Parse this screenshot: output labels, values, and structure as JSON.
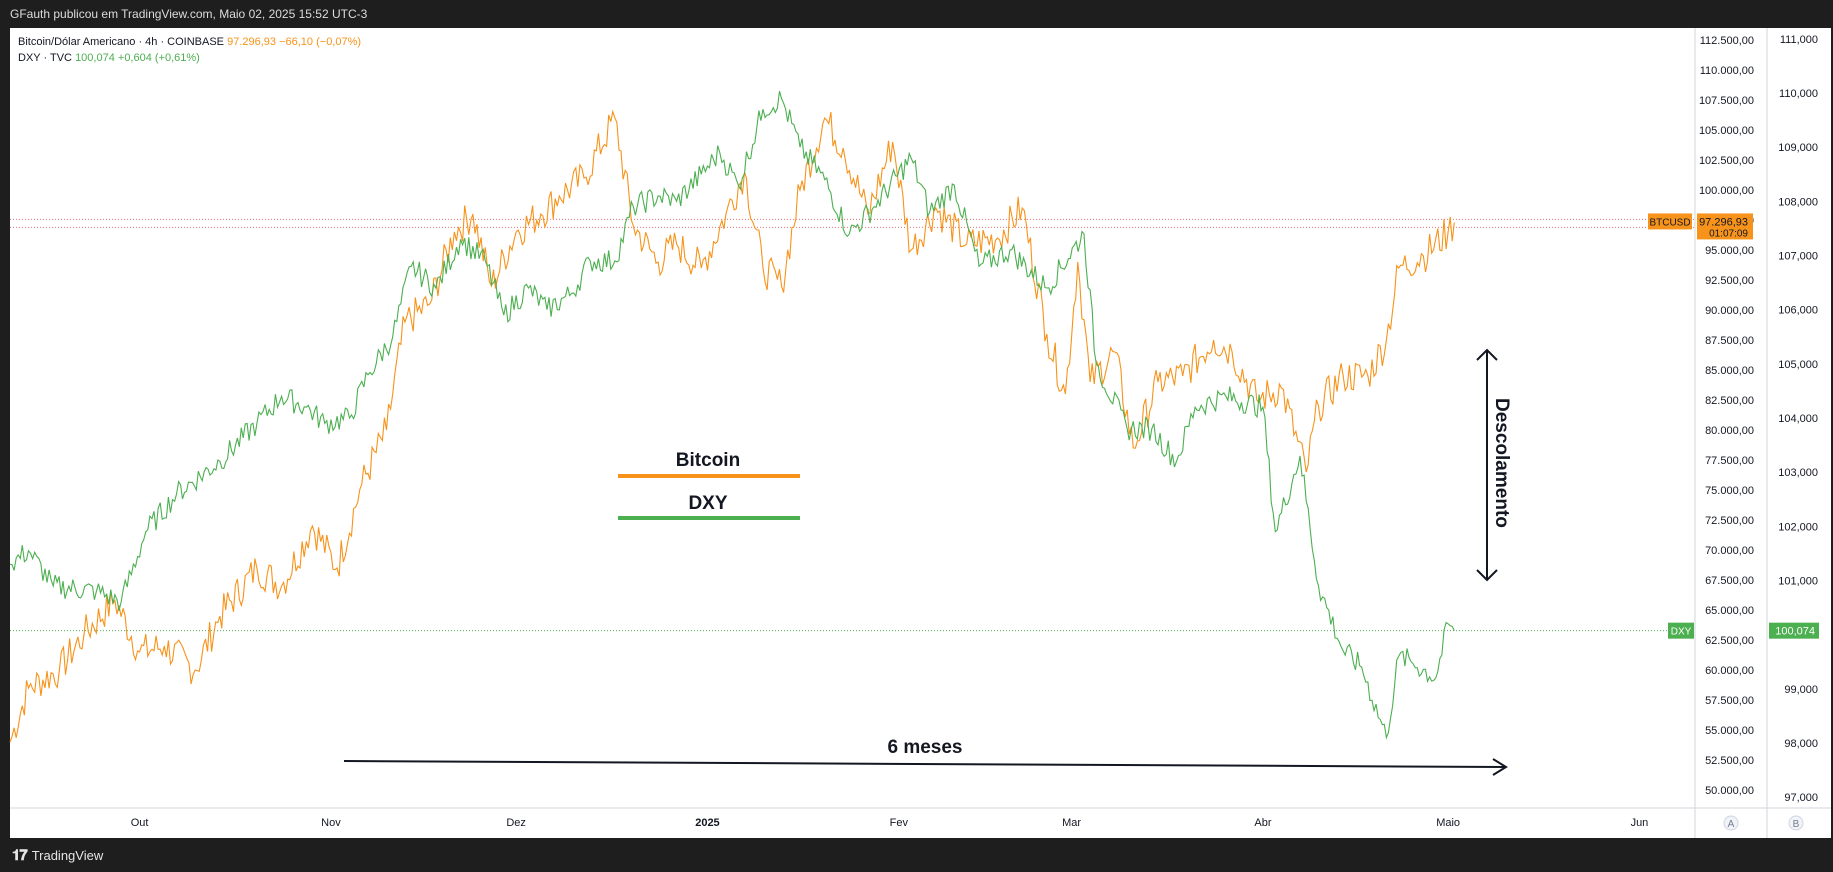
{
  "header": {
    "publisher_line": "GFauth publicou em TradingView.com, Maio 02, 2025 15:52 UTC-3"
  },
  "legend": {
    "btc": {
      "name": "Bitcoin/Dólar Americano · 4h · COINBASE",
      "price": "97.296,93",
      "change": "−66,10 (−0,07%)"
    },
    "dxy": {
      "name": "DXY · TVC",
      "price": "100,074",
      "change": "+0,604 (+0,61%)"
    }
  },
  "footer": {
    "brand": "TradingView"
  },
  "chart_data": {
    "type": "line",
    "x_label_months": [
      "Out",
      "Nov",
      "Dez",
      "2025",
      "Fev",
      "Mar",
      "Abr",
      "Maio",
      "Jun"
    ],
    "x_range": [
      "2024-09-10",
      "2025-06-10"
    ],
    "series": [
      {
        "name": "BTCUSD",
        "axis": "A",
        "color": "#f7931a",
        "points": [
          [
            "2024-09-10",
            54000
          ],
          [
            "2024-09-13",
            58500
          ],
          [
            "2024-09-18",
            60000
          ],
          [
            "2024-09-22",
            63000
          ],
          [
            "2024-09-27",
            65800
          ],
          [
            "2024-10-01",
            61500
          ],
          [
            "2024-10-05",
            62000
          ],
          [
            "2024-10-10",
            60000
          ],
          [
            "2024-10-14",
            64500
          ],
          [
            "2024-10-20",
            68500
          ],
          [
            "2024-10-24",
            67000
          ],
          [
            "2024-10-29",
            72000
          ],
          [
            "2024-11-02",
            68500
          ],
          [
            "2024-11-06",
            75500
          ],
          [
            "2024-11-10",
            80000
          ],
          [
            "2024-11-13",
            89000
          ],
          [
            "2024-11-17",
            90500
          ],
          [
            "2024-11-21",
            96500
          ],
          [
            "2024-11-24",
            98000
          ],
          [
            "2024-11-27",
            92000
          ],
          [
            "2024-12-01",
            96500
          ],
          [
            "2024-12-05",
            98000
          ],
          [
            "2024-12-08",
            99500
          ],
          [
            "2024-12-12",
            101000
          ],
          [
            "2024-12-17",
            106000
          ],
          [
            "2024-12-20",
            97000
          ],
          [
            "2024-12-24",
            94000
          ],
          [
            "2024-12-27",
            95500
          ],
          [
            "2024-12-31",
            93500
          ],
          [
            "2025-01-04",
            98000
          ],
          [
            "2025-01-07",
            101500
          ],
          [
            "2025-01-10",
            93500
          ],
          [
            "2025-01-13",
            92000
          ],
          [
            "2025-01-16",
            100000
          ],
          [
            "2025-01-20",
            106000
          ],
          [
            "2025-01-23",
            103500
          ],
          [
            "2025-01-27",
            98000
          ],
          [
            "2025-01-31",
            104000
          ],
          [
            "2025-02-03",
            95000
          ],
          [
            "2025-02-07",
            98500
          ],
          [
            "2025-02-12",
            95500
          ],
          [
            "2025-02-17",
            96000
          ],
          [
            "2025-02-21",
            98500
          ],
          [
            "2025-02-25",
            88000
          ],
          [
            "2025-02-28",
            83000
          ],
          [
            "2025-03-02",
            94000
          ],
          [
            "2025-03-04",
            84000
          ],
          [
            "2025-03-08",
            86500
          ],
          [
            "2025-03-11",
            78500
          ],
          [
            "2025-03-15",
            84000
          ],
          [
            "2025-03-19",
            84500
          ],
          [
            "2025-03-24",
            87500
          ],
          [
            "2025-03-27",
            86500
          ],
          [
            "2025-03-31",
            82500
          ],
          [
            "2025-04-04",
            83500
          ],
          [
            "2025-04-08",
            76500
          ],
          [
            "2025-04-10",
            82000
          ],
          [
            "2025-04-14",
            84500
          ],
          [
            "2025-04-18",
            84500
          ],
          [
            "2025-04-21",
            87500
          ],
          [
            "2025-04-23",
            93500
          ],
          [
            "2025-04-27",
            94500
          ],
          [
            "2025-05-01",
            96500
          ],
          [
            "2025-05-02",
            97296.93
          ]
        ]
      },
      {
        "name": "DXY",
        "axis": "B",
        "color": "#4caf50",
        "points": [
          [
            "2024-09-10",
            101.3
          ],
          [
            "2024-09-13",
            101.55
          ],
          [
            "2024-09-17",
            100.9
          ],
          [
            "2024-09-24",
            100.8
          ],
          [
            "2024-09-28",
            100.6
          ],
          [
            "2024-10-02",
            101.9
          ],
          [
            "2024-10-07",
            102.6
          ],
          [
            "2024-10-14",
            103.2
          ],
          [
            "2024-10-20",
            103.9
          ],
          [
            "2024-10-24",
            104.4
          ],
          [
            "2024-10-28",
            104.2
          ],
          [
            "2024-10-31",
            103.9
          ],
          [
            "2024-11-04",
            104.0
          ],
          [
            "2024-11-07",
            104.8
          ],
          [
            "2024-11-11",
            105.5
          ],
          [
            "2024-11-14",
            106.8
          ],
          [
            "2024-11-18",
            106.4
          ],
          [
            "2024-11-22",
            107.3
          ],
          [
            "2024-11-26",
            106.9
          ],
          [
            "2024-11-29",
            105.9
          ],
          [
            "2024-12-03",
            106.4
          ],
          [
            "2024-12-06",
            106.0
          ],
          [
            "2024-12-10",
            106.3
          ],
          [
            "2024-12-13",
            106.9
          ],
          [
            "2024-12-17",
            106.9
          ],
          [
            "2024-12-20",
            107.9
          ],
          [
            "2024-12-24",
            108.1
          ],
          [
            "2024-12-27",
            108.0
          ],
          [
            "2024-12-31",
            108.5
          ],
          [
            "2025-01-03",
            108.9
          ],
          [
            "2025-01-06",
            108.3
          ],
          [
            "2025-01-10",
            109.7
          ],
          [
            "2025-01-13",
            109.9
          ],
          [
            "2025-01-16",
            109.0
          ],
          [
            "2025-01-20",
            108.4
          ],
          [
            "2025-01-24",
            107.4
          ],
          [
            "2025-01-28",
            107.9
          ],
          [
            "2025-02-03",
            108.8
          ],
          [
            "2025-02-06",
            107.8
          ],
          [
            "2025-02-10",
            108.3
          ],
          [
            "2025-02-14",
            106.8
          ],
          [
            "2025-02-19",
            107.1
          ],
          [
            "2025-02-25",
            106.4
          ],
          [
            "2025-03-03",
            107.4
          ],
          [
            "2025-03-05",
            105.0
          ],
          [
            "2025-03-10",
            103.8
          ],
          [
            "2025-03-14",
            103.8
          ],
          [
            "2025-03-18",
            103.2
          ],
          [
            "2025-03-21",
            104.2
          ],
          [
            "2025-03-26",
            104.4
          ],
          [
            "2025-04-01",
            104.2
          ],
          [
            "2025-04-03",
            101.9
          ],
          [
            "2025-04-07",
            103.3
          ],
          [
            "2025-04-10",
            100.9
          ],
          [
            "2025-04-14",
            99.7
          ],
          [
            "2025-04-17",
            99.4
          ],
          [
            "2025-04-21",
            98.1
          ],
          [
            "2025-04-23",
            99.6
          ],
          [
            "2025-04-25",
            99.5
          ],
          [
            "2025-04-29",
            99.2
          ],
          [
            "2025-05-01",
            100.2
          ],
          [
            "2025-05-02",
            100.074
          ]
        ]
      }
    ],
    "axis_a": {
      "range": [
        48500,
        113500
      ],
      "ticks": [
        "112.500,00",
        "110.000,00",
        "107.500,00",
        "105.000,00",
        "102.500,00",
        "100.000,00",
        "97.500,00",
        "95.000,00",
        "92.500,00",
        "90.000,00",
        "87.500,00",
        "85.000,00",
        "82.500,00",
        "80.000,00",
        "77.500,00",
        "75.000,00",
        "72.500,00",
        "70.000,00",
        "67.500,00",
        "65.000,00",
        "62.500,00",
        "60.000,00",
        "57.500,00",
        "55.000,00",
        "52.500,00",
        "50.000,00"
      ],
      "tick_values": [
        112500,
        110000,
        107500,
        105000,
        102500,
        100000,
        97500,
        95000,
        92500,
        90000,
        87500,
        85000,
        82500,
        80000,
        77500,
        75000,
        72500,
        70000,
        67500,
        65000,
        62500,
        60000,
        57500,
        55000,
        52500,
        50000
      ],
      "footer_label": "A"
    },
    "axis_b": {
      "range": [
        96.8,
        111.2
      ],
      "ticks": [
        "111,000",
        "110,000",
        "109,000",
        "108,000",
        "107,000",
        "106,000",
        "105,000",
        "104,000",
        "103,000",
        "102,000",
        "101,000",
        "99,000",
        "98,000",
        "97,000"
      ],
      "tick_values": [
        111,
        110,
        109,
        108,
        107,
        106,
        105,
        104,
        103,
        102,
        101,
        99,
        98,
        97
      ],
      "footer_label": "B"
    },
    "last_price_tags": {
      "btc": {
        "symbol": "BTCUSD",
        "value": "97.296,93",
        "countdown": "01:07:09",
        "price": 97296.93,
        "color": "#f7931a"
      },
      "dxy": {
        "symbol": "DXY",
        "value": "100,074",
        "price": 100.074,
        "color": "#4caf50"
      }
    },
    "annotations": {
      "legend_btc": {
        "text": "Bitcoin",
        "color": "#f7931a"
      },
      "legend_dxy": {
        "text": "DXY",
        "color": "#4caf50"
      },
      "vertical_arrow_label": "Descolamento",
      "horizontal_arrow_label": "6 meses"
    }
  }
}
